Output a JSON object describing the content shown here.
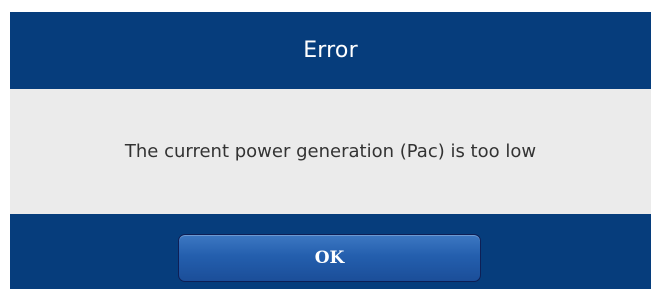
{
  "dialog": {
    "title": "Error",
    "message": "The current power generation (Pac) is too low",
    "ok_label": "OK"
  },
  "colors": {
    "header_background": "#063d7c",
    "body_background": "#ebebeb",
    "button_background": "#245fae",
    "title_text": "#ffffff",
    "message_text": "#333333"
  }
}
